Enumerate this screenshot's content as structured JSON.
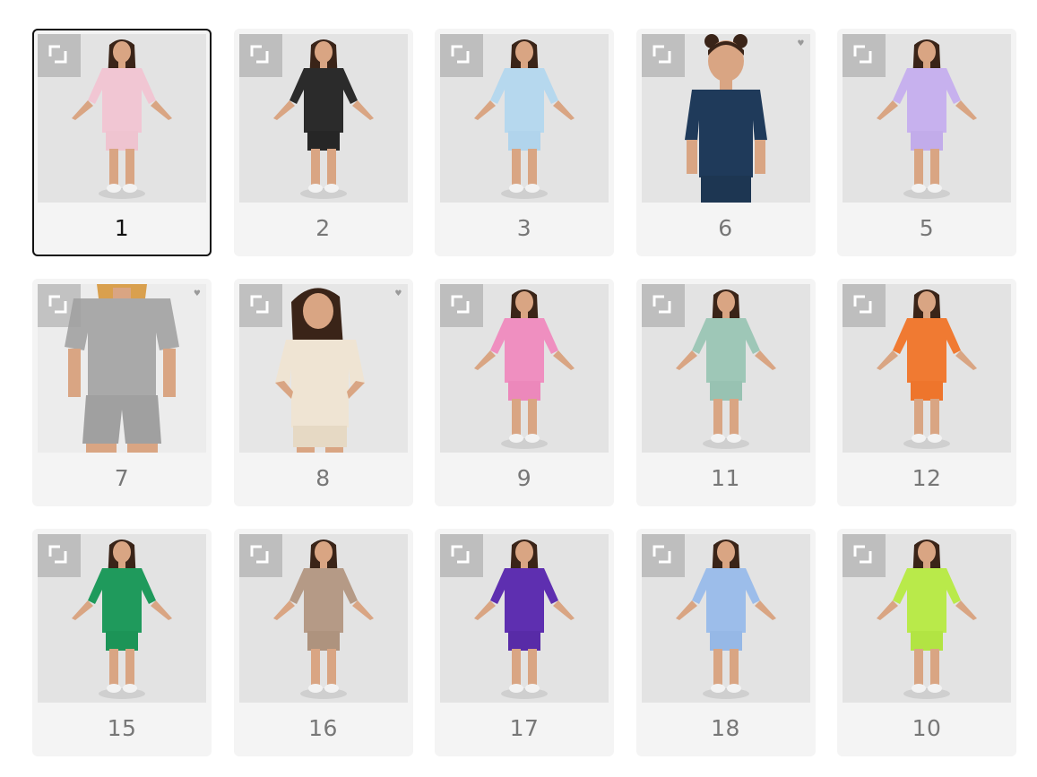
{
  "variants": [
    {
      "label": "1",
      "color": "#f1c6d3",
      "shorts": "#efc4d0",
      "selected": true,
      "heart": false,
      "pose": "stand"
    },
    {
      "label": "2",
      "color": "#2b2b2b",
      "shorts": "#262626",
      "selected": false,
      "heart": false,
      "pose": "stand"
    },
    {
      "label": "3",
      "color": "#b6d8ee",
      "shorts": "#b1d4ec",
      "selected": false,
      "heart": false,
      "pose": "stand"
    },
    {
      "label": "6",
      "color": "#1f3a5a",
      "shorts": "#1d3652",
      "selected": false,
      "heart": true,
      "pose": "close"
    },
    {
      "label": "5",
      "color": "#c7b1ee",
      "shorts": "#c2acea",
      "selected": false,
      "heart": false,
      "pose": "stand"
    },
    {
      "label": "7",
      "color": "#a9a9a9",
      "shorts": "#a0a0a0",
      "selected": false,
      "heart": true,
      "pose": "crop"
    },
    {
      "label": "8",
      "color": "#efe4d3",
      "shorts": "#e6d9c4",
      "selected": false,
      "heart": true,
      "pose": "hips"
    },
    {
      "label": "9",
      "color": "#ef8fc0",
      "shorts": "#ec88bb",
      "selected": false,
      "heart": false,
      "pose": "stand"
    },
    {
      "label": "11",
      "color": "#9ec7b7",
      "shorts": "#98c2b2",
      "selected": false,
      "heart": false,
      "pose": "stand"
    },
    {
      "label": "12",
      "color": "#f07a32",
      "shorts": "#ee752c",
      "selected": false,
      "heart": false,
      "pose": "stand"
    },
    {
      "label": "15",
      "color": "#1f9a5c",
      "shorts": "#1c9457",
      "selected": false,
      "heart": false,
      "pose": "stand"
    },
    {
      "label": "16",
      "color": "#b59a86",
      "shorts": "#ae937e",
      "selected": false,
      "heart": false,
      "pose": "stand"
    },
    {
      "label": "17",
      "color": "#5e2fb0",
      "shorts": "#582ba7",
      "selected": false,
      "heart": false,
      "pose": "stand"
    },
    {
      "label": "18",
      "color": "#9cbdea",
      "shorts": "#96b8e6",
      "selected": false,
      "heart": false,
      "pose": "stand"
    },
    {
      "label": "10",
      "color": "#b9ea4a",
      "shorts": "#b2e443",
      "selected": false,
      "heart": false,
      "pose": "stand"
    }
  ],
  "icons": {
    "zoom": "expand-corners-icon",
    "heart": "heart-icon"
  }
}
